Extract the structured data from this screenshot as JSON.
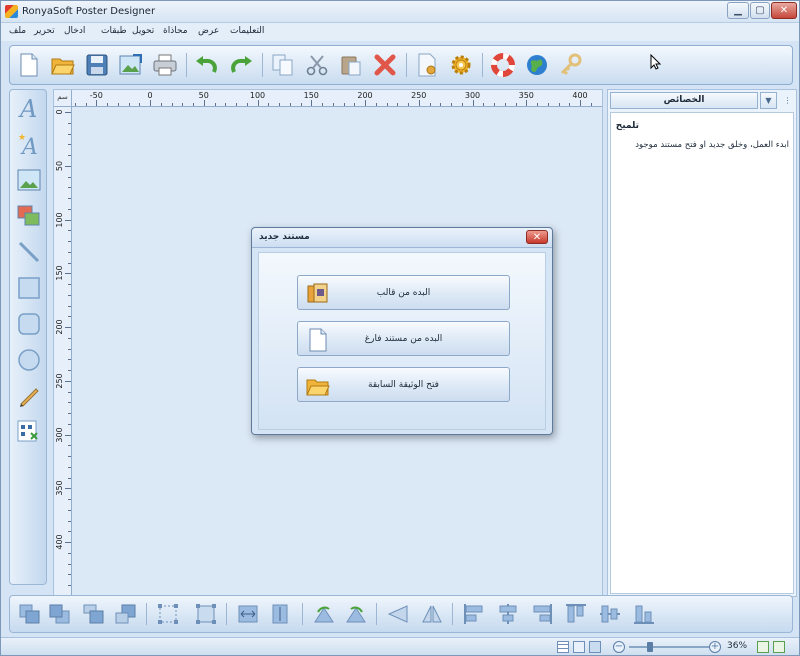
{
  "window": {
    "title": "RonyaSoft Poster Designer"
  },
  "title_buttons": {
    "minimize": "▁",
    "maximize": "▢",
    "close": "✕"
  },
  "menu": [
    "ملف",
    "تحرير",
    "ادخال",
    "طبقات",
    "تحويل",
    "محاذاة",
    "عرض",
    "التعليمات"
  ],
  "toolbar": [
    "new-document-icon",
    "open-folder-icon",
    "save-icon",
    "export-image-icon",
    "print-icon",
    "undo-icon",
    "redo-icon",
    "copy-icon",
    "cut-icon",
    "paste-icon",
    "delete-icon",
    "page-setup-icon",
    "settings-gear-icon",
    "help-lifebuoy-icon",
    "web-globe-icon",
    "register-key-icon"
  ],
  "left_tools": [
    "text-icon",
    "curved-text-icon",
    "image-icon",
    "clipart-icon",
    "line-icon",
    "rectangle-icon",
    "rounded-rectangle-icon",
    "ellipse-icon",
    "pencil-icon",
    "qr-code-icon"
  ],
  "ruler": {
    "unit": "سم",
    "x_labels": [
      "-50",
      "0",
      "50",
      "100",
      "150",
      "200",
      "250",
      "300",
      "350",
      "400"
    ],
    "y_labels": [
      "0",
      "50",
      "100",
      "150",
      "200",
      "250",
      "300",
      "350",
      "400"
    ]
  },
  "properties_panel": {
    "tab": "الخصائص",
    "hint_title": "تلميح",
    "hint_text": "ابدء العمل، وخلق جديد او فتح مستند موجود"
  },
  "dialog": {
    "title": "مستند جديد",
    "buttons": [
      {
        "label": "البده من قالب",
        "icon": "template-icon"
      },
      {
        "label": "البده من مستند فارغ",
        "icon": "blank-document-icon"
      },
      {
        "label": "فتح الوثيقة السابقة",
        "icon": "folder-icon"
      }
    ]
  },
  "bottom_tools": [
    "bring-to-front-icon",
    "send-to-back-icon",
    "bring-forward-icon",
    "send-backward-icon",
    "group-icon",
    "ungroup-icon",
    "same-width-icon",
    "same-height-icon",
    "rotate-left-icon",
    "rotate-right-icon",
    "flip-horizontal-icon",
    "flip-vertical-icon",
    "align-left-icon",
    "align-center-icon",
    "align-right-icon",
    "align-top-icon",
    "align-middle-icon",
    "align-bottom-icon"
  ],
  "status": {
    "zoom": "36%"
  },
  "colors": {
    "accent": "#2c8ad8",
    "close_red": "#c6392c",
    "panel_bg": "#d5e4f4"
  }
}
